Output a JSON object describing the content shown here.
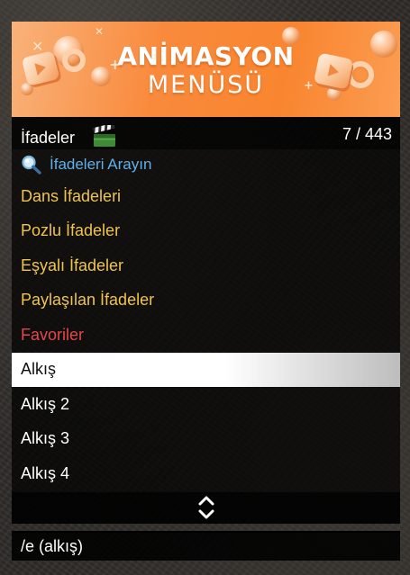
{
  "banner": {
    "title": "ANİMASYON",
    "subtitle": "MENÜSÜ",
    "accent_color": "#f9852f"
  },
  "menu": {
    "title": "İfadeler",
    "title_icon": "clapperboard-icon",
    "counter": "7 / 443",
    "search": {
      "icon": "magnifier-icon",
      "label": "İfadeleri Arayın",
      "color": "#5fb0ea"
    },
    "categories": [
      {
        "label": "Dans İfadeleri"
      },
      {
        "label": "Pozlu İfadeler"
      },
      {
        "label": "Eşyalı İfadeler"
      },
      {
        "label": "Paylaşılan İfadeler"
      }
    ],
    "category_color": "#efc44e",
    "favorites": {
      "label": "Favoriler",
      "color": "#e3474b"
    },
    "items": [
      {
        "label": "Alkış",
        "selected": true
      },
      {
        "label": "Alkış 2",
        "selected": false
      },
      {
        "label": "Alkış 3",
        "selected": false
      },
      {
        "label": "Alkış 4",
        "selected": false
      }
    ],
    "scroll_icon": "up-down-chevron-icon",
    "footer": "/e (alkış)"
  }
}
